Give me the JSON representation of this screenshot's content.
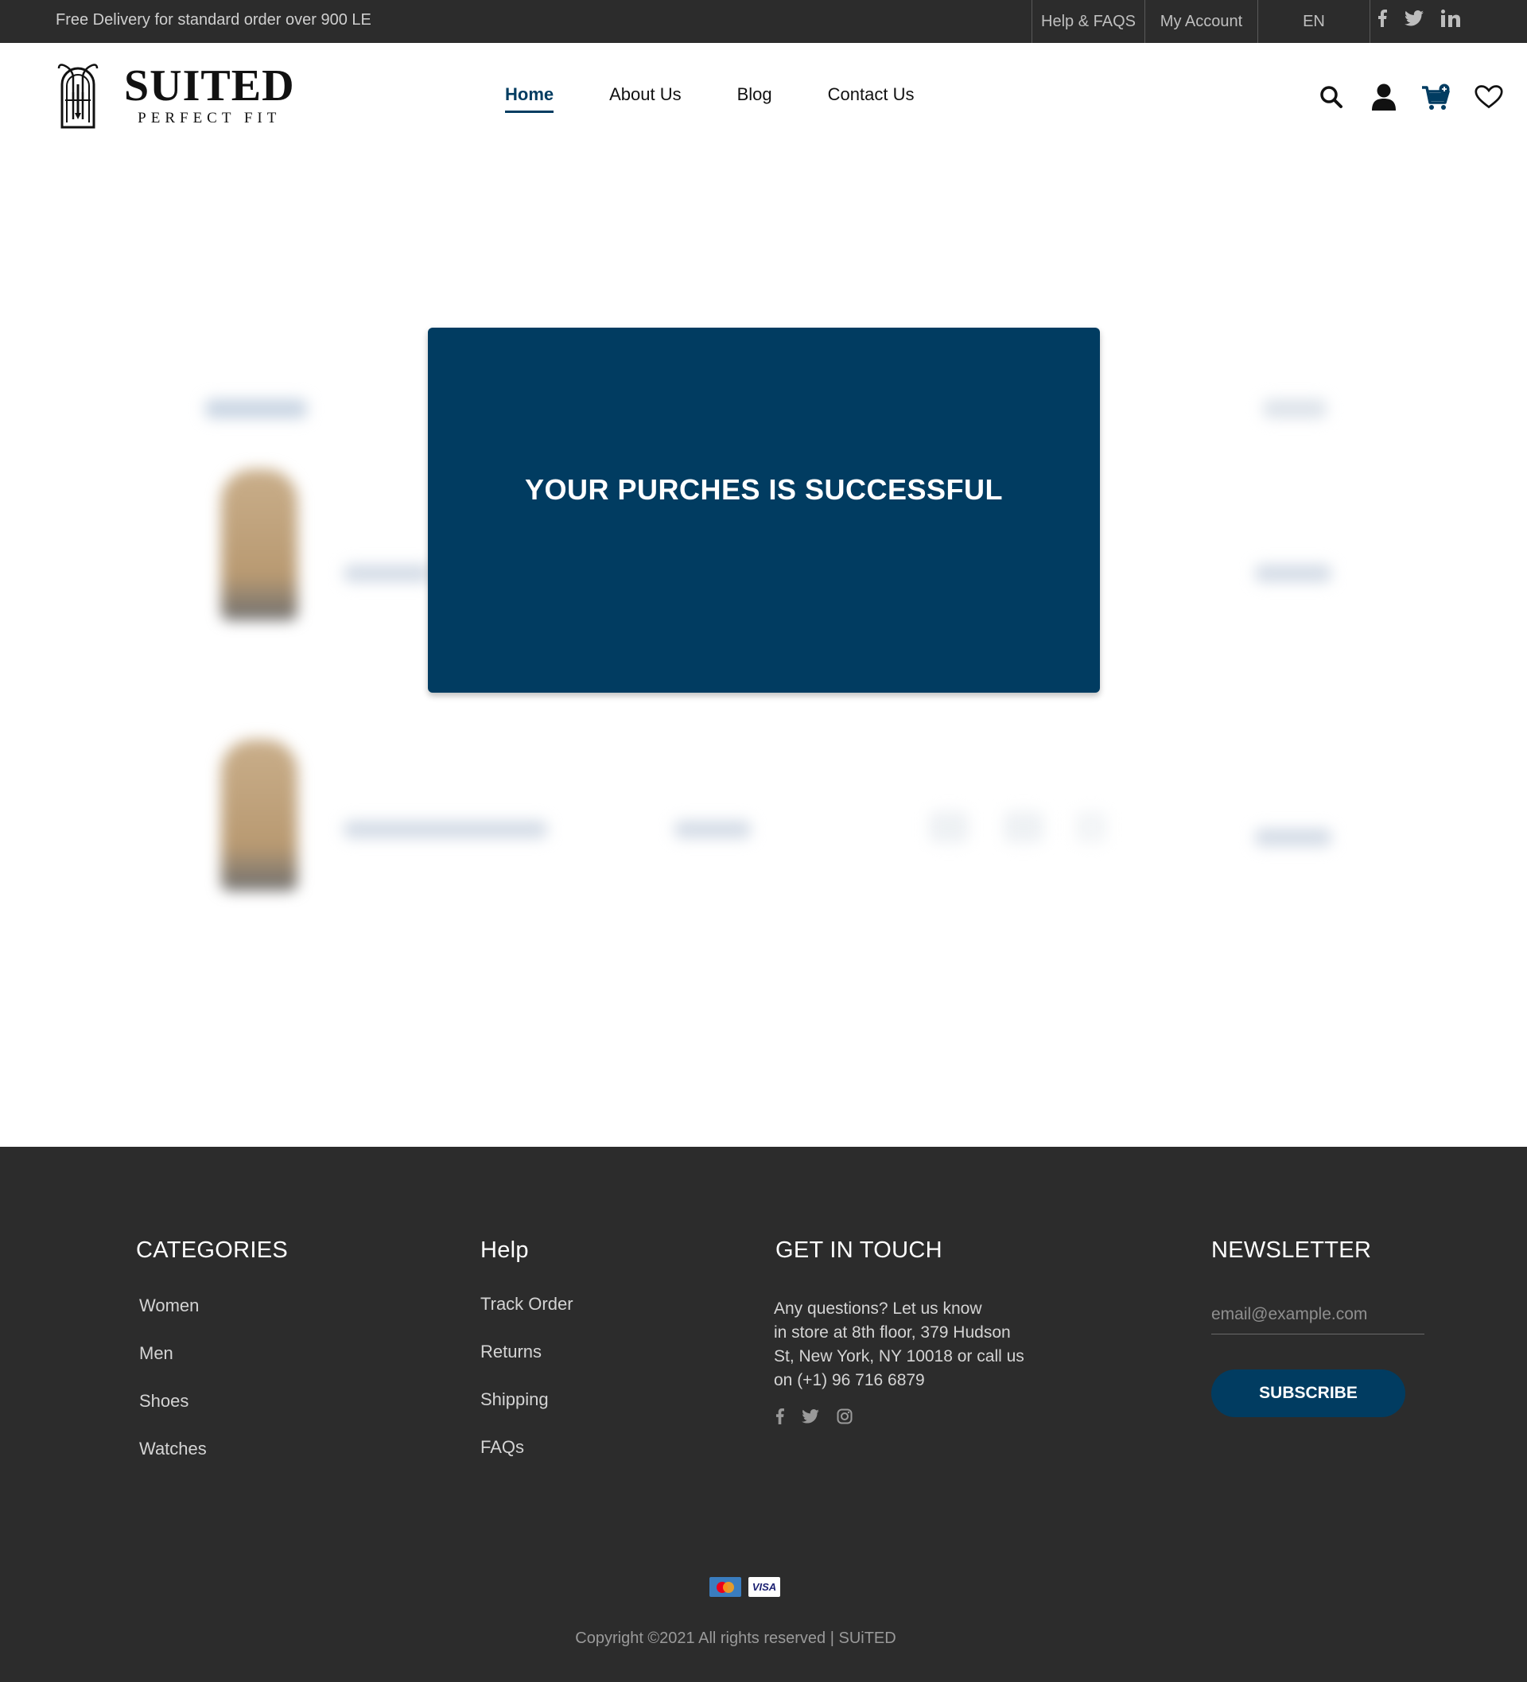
{
  "topbar": {
    "promo": "Free Delivery for standard order over 900 LE",
    "links": [
      "Help & FAQS",
      "My Account",
      "EN"
    ],
    "social_icons": [
      "facebook-icon",
      "twitter-icon",
      "linkedin-icon"
    ]
  },
  "header": {
    "brand": "SUITED",
    "tagline": "PERFECT FIT",
    "nav": [
      {
        "label": "Home",
        "active": true
      },
      {
        "label": "About Us",
        "active": false
      },
      {
        "label": "Blog",
        "active": false
      },
      {
        "label": "Contact Us",
        "active": false
      }
    ],
    "icons": [
      "search-icon",
      "user-icon",
      "cart-icon",
      "heart-icon"
    ]
  },
  "modal": {
    "message": "YOUR PURCHES IS SUCCESSFUL"
  },
  "footer": {
    "categories": {
      "title": "CATEGORIES",
      "items": [
        "Women",
        "Men",
        "Shoes",
        "Watches"
      ]
    },
    "help": {
      "title": "Help",
      "items": [
        "Track Order",
        "Returns",
        "Shipping",
        "FAQs"
      ]
    },
    "contact": {
      "title": "GET IN TOUCH",
      "text": "Any questions? Let us know\n in store at 8th floor, 379 Hudson\n St, New York, NY 10018 or call us\n on (+1) 96 716 6879",
      "social_icons": [
        "facebook-icon",
        "twitter-icon",
        "instagram-icon"
      ]
    },
    "newsletter": {
      "title": "NEWSLETTER",
      "placeholder": "email@example.com",
      "button": "SUBSCRIBE"
    },
    "payment_icons": [
      "mastercard-icon",
      "visa-icon"
    ],
    "visa_label": "VISA",
    "copyright": "Copyright ©2021 All rights reserved | SUiTED"
  },
  "colors": {
    "brand_navy": "#013c61",
    "dark_bg": "#2c2c2c"
  }
}
